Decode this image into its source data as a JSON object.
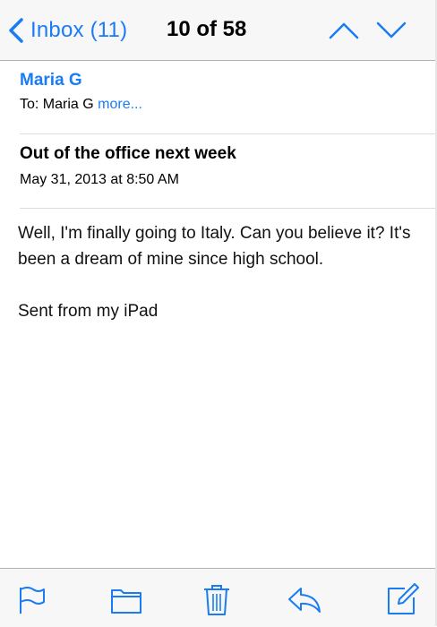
{
  "navbar": {
    "back_label": "Inbox (11)",
    "position": "10 of 58",
    "icons": {
      "back": "chevron-left-icon",
      "previous": "chevron-up-icon",
      "next": "chevron-down-icon"
    }
  },
  "message": {
    "sender": "Maria G",
    "to_prefix": "To:",
    "to_name": "Maria G",
    "more_label": "more...",
    "subject": "Out of the office next week",
    "date": "May 31, 2013 at 8:50 AM",
    "body": "Well, I'm finally going to Italy. Can you believe it? It's been a dream of mine since high school.",
    "signature": "Sent from my iPad"
  },
  "toolbar": {
    "icons": [
      "flag-icon",
      "folder-icon",
      "trash-icon",
      "reply-icon",
      "compose-icon"
    ]
  },
  "colors": {
    "accent": "#1a7cf5",
    "bar_background": "#f7f7f8",
    "separator": "#b2b2b2"
  }
}
